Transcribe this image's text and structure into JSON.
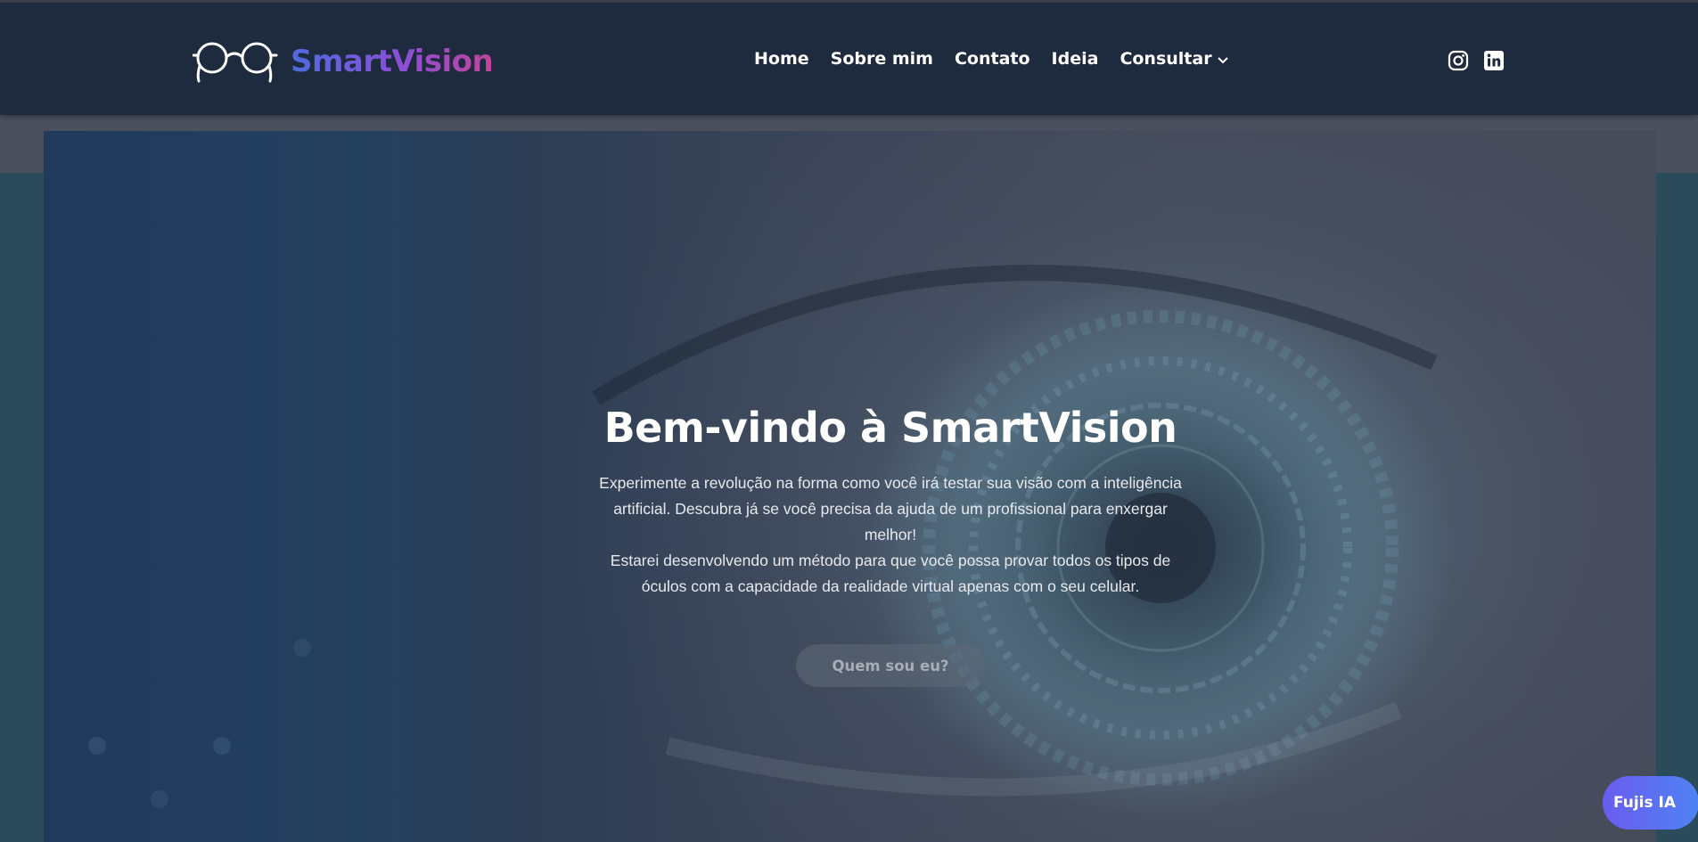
{
  "brand": {
    "logo_icon": "glasses-icon",
    "name": "SmartVision",
    "gradient": [
      "#4f6be0",
      "#8a4fd6",
      "#c2459a"
    ]
  },
  "nav": {
    "items": [
      {
        "label": "Home"
      },
      {
        "label": "Sobre mim"
      },
      {
        "label": "Contato"
      },
      {
        "label": "Ideia"
      },
      {
        "label": "Consultar",
        "icon": "chevron-down-icon"
      }
    ]
  },
  "social": {
    "icons": [
      "instagram-icon",
      "linkedin-icon"
    ]
  },
  "hero": {
    "title": "Bem-vindo à SmartVision",
    "paragraph_1": "Experimente a revolução na forma como você irá testar sua visão com a inteligência artificial. Descubra já se você precisa da ajuda de um profissional para enxergar melhor!",
    "paragraph_2": "Estarei desenvolvendo um método para que você possa provar todos os tipos de óculos com a capacidade da realidade virtual apenas com o seu celular.",
    "button_label": "Quem sou eu?"
  },
  "chat": {
    "label": "Fujis IA",
    "accent": "#6a5cf0"
  },
  "colors": {
    "navbar_bg": "#1e2a3d",
    "text": "#ffffff"
  }
}
